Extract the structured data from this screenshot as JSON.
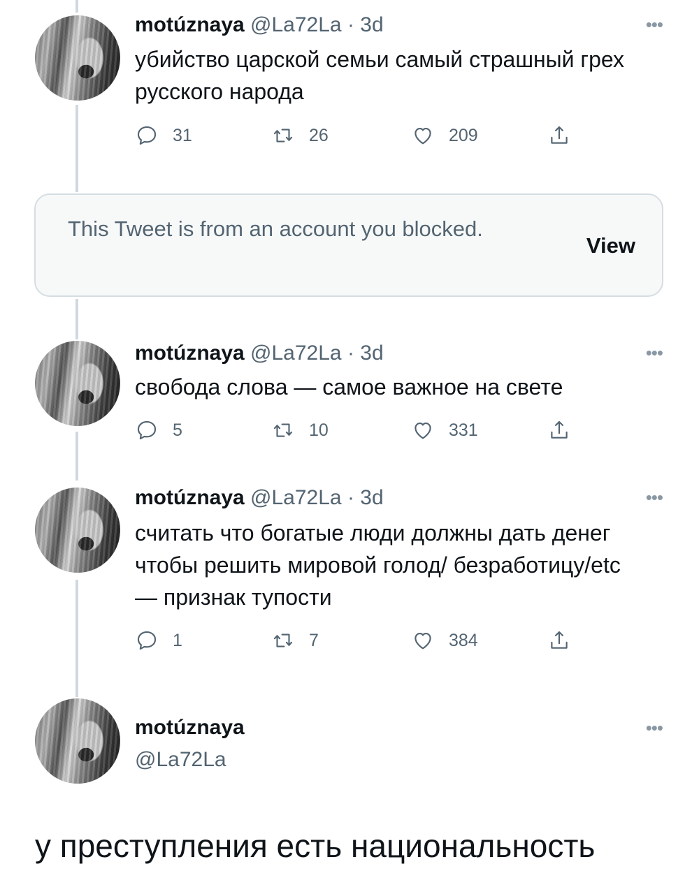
{
  "tweets": [
    {
      "name": "motúznaya",
      "handle": "@La72La",
      "sep": "·",
      "time": "3d",
      "more": "•••",
      "text": "убийство царской семьи самый страшный грех русского народа",
      "replies": "31",
      "retweets": "26",
      "likes": "209"
    },
    {
      "name": "motúznaya",
      "handle": "@La72La",
      "sep": "·",
      "time": "3d",
      "more": "•••",
      "text": "свобода слова — самое важное на свете",
      "replies": "5",
      "retweets": "10",
      "likes": "331"
    },
    {
      "name": "motúznaya",
      "handle": "@La72La",
      "sep": "·",
      "time": "3d",
      "more": "•••",
      "text": "считать что богатые люди должны дать денег чтобы решить мировой голод/ безработицу/etc — признак тупости",
      "replies": "1",
      "retweets": "7",
      "likes": "384"
    }
  ],
  "blocked_notice": {
    "text": "This Tweet is from an account you blocked.",
    "button": "View"
  },
  "main_tweet": {
    "name": "motúznaya",
    "handle": "@La72La",
    "more": "•••",
    "text": "у преступления есть национальность"
  },
  "icons": {
    "reply": "reply-icon",
    "retweet": "retweet-icon",
    "like": "heart-icon",
    "share": "share-icon",
    "more": "more-icon"
  },
  "colors": {
    "text": "#0f1419",
    "secondary": "#536471",
    "thread_line": "#cfd9de",
    "notice_bg": "#f7f9f9"
  }
}
